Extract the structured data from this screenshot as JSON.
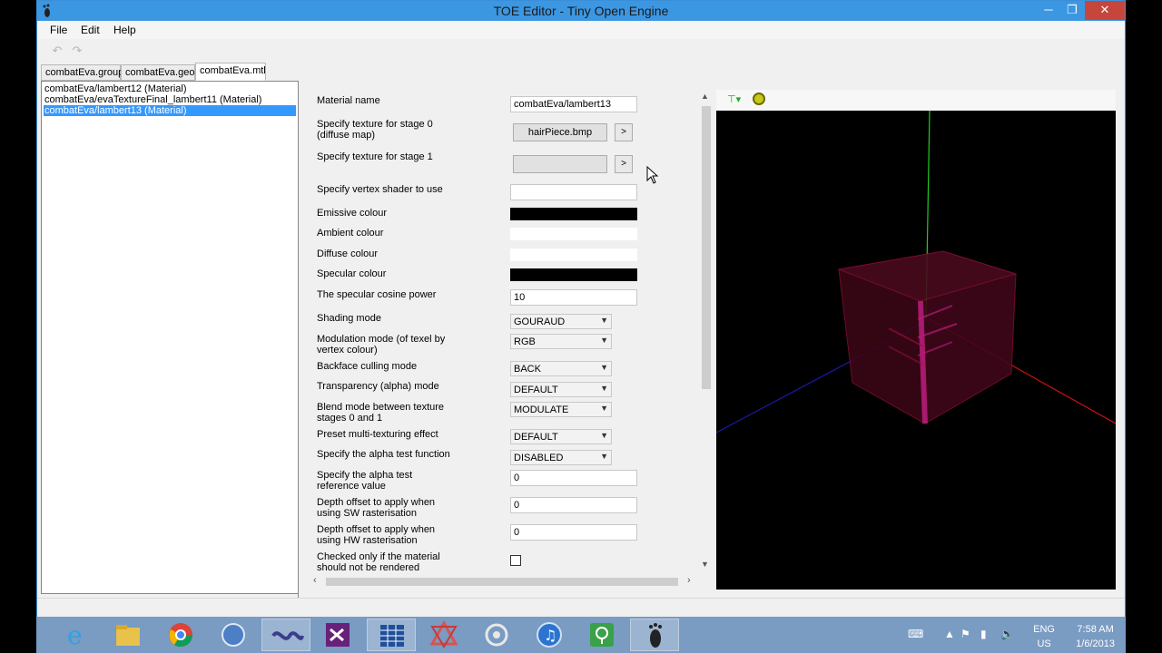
{
  "window": {
    "title": "TOE Editor - Tiny Open Engine",
    "minimize_glyph": "─",
    "maximize_glyph": "❐",
    "close_glyph": "✕"
  },
  "menu": [
    "File",
    "Edit",
    "Help"
  ],
  "toolbar": {
    "undo_icon": "undo-icon",
    "redo_icon": "redo-icon"
  },
  "tabs": [
    {
      "label": "combatEva.group",
      "active": false
    },
    {
      "label": "combatEva.geo",
      "active": false
    },
    {
      "label": "combatEva.mtl",
      "active": true
    }
  ],
  "materials": [
    {
      "label": "combatEva/lambert12 (Material)",
      "selected": false
    },
    {
      "label": "combatEva/evaTextureFinal_lambert11 (Material)",
      "selected": false
    },
    {
      "label": "combatEva/lambert13 (Material)",
      "selected": true
    }
  ],
  "properties": {
    "material_name": {
      "label": "Material name",
      "value": "combatEva/lambert13"
    },
    "texture_stage0": {
      "label_line1": "Specify texture for stage 0",
      "label_line2": "(diffuse map)",
      "value": "hairPiece.bmp",
      "arrow": ">"
    },
    "texture_stage1": {
      "label": "Specify texture for stage 1",
      "value": "",
      "arrow": ">"
    },
    "vertex_shader": {
      "label": "Specify vertex shader to use",
      "value": ""
    },
    "emissive": {
      "label": "Emissive colour",
      "color": "#000000"
    },
    "ambient": {
      "label": "Ambient colour",
      "color": "#ffffff"
    },
    "diffuse": {
      "label": "Diffuse colour",
      "color": "#ffffff"
    },
    "specular": {
      "label": "Specular colour",
      "color": "#000000"
    },
    "specular_power": {
      "label": "The specular cosine power",
      "value": "10"
    },
    "shading_mode": {
      "label": "Shading mode",
      "value": "GOURAUD"
    },
    "modulation_mode": {
      "label_line1": "Modulation mode (of texel by",
      "label_line2": "vertex colour)",
      "value": "RGB"
    },
    "backface_culling": {
      "label": "Backface culling mode",
      "value": "BACK"
    },
    "transparency_mode": {
      "label": "Transparency (alpha) mode",
      "value": "DEFAULT"
    },
    "blend_mode": {
      "label_line1": "Blend mode between texture",
      "label_line2": "stages 0 and 1",
      "value": "MODULATE"
    },
    "multitexture_effect": {
      "label": "Preset multi-texturing effect",
      "value": "DEFAULT"
    },
    "alpha_test_function": {
      "label": "Specify the alpha test function",
      "value": "DISABLED"
    },
    "alpha_test_ref": {
      "label_line1": "Specify the alpha test",
      "label_line2": "reference value",
      "value": "0"
    },
    "depth_offset_sw": {
      "label_line1": "Depth offset to apply when",
      "label_line2": "using SW rasterisation",
      "value": "0"
    },
    "depth_offset_hw": {
      "label_line1": "Depth offset to apply when",
      "label_line2": "using HW rasterisation",
      "value": "0"
    },
    "not_rendered": {
      "label_line1": "Checked only if the material",
      "label_line2": "should not be rendered",
      "checked": false
    }
  },
  "taskbar": {
    "apps": [
      "internet-explorer-icon",
      "file-explorer-icon",
      "chrome-icon",
      "app-icon",
      "visual-studio-icon-alt",
      "visual-studio-icon",
      "spreadsheet-icon",
      "3d-app-icon",
      "network-app-icon",
      "itunes-icon",
      "green-app-icon",
      "toe-editor-icon"
    ],
    "lang_line1": "ENG",
    "lang_line2": "US",
    "time": "7:58 AM",
    "date": "1/6/2013"
  },
  "colors": {
    "titlebar": "#3c97e2",
    "selection": "#3399ff",
    "taskbar": "#7a9bc2",
    "axis_green": "#22cc22",
    "axis_red": "#cc1111",
    "axis_blue": "#1a1aaa",
    "mesh": "#b01050"
  }
}
